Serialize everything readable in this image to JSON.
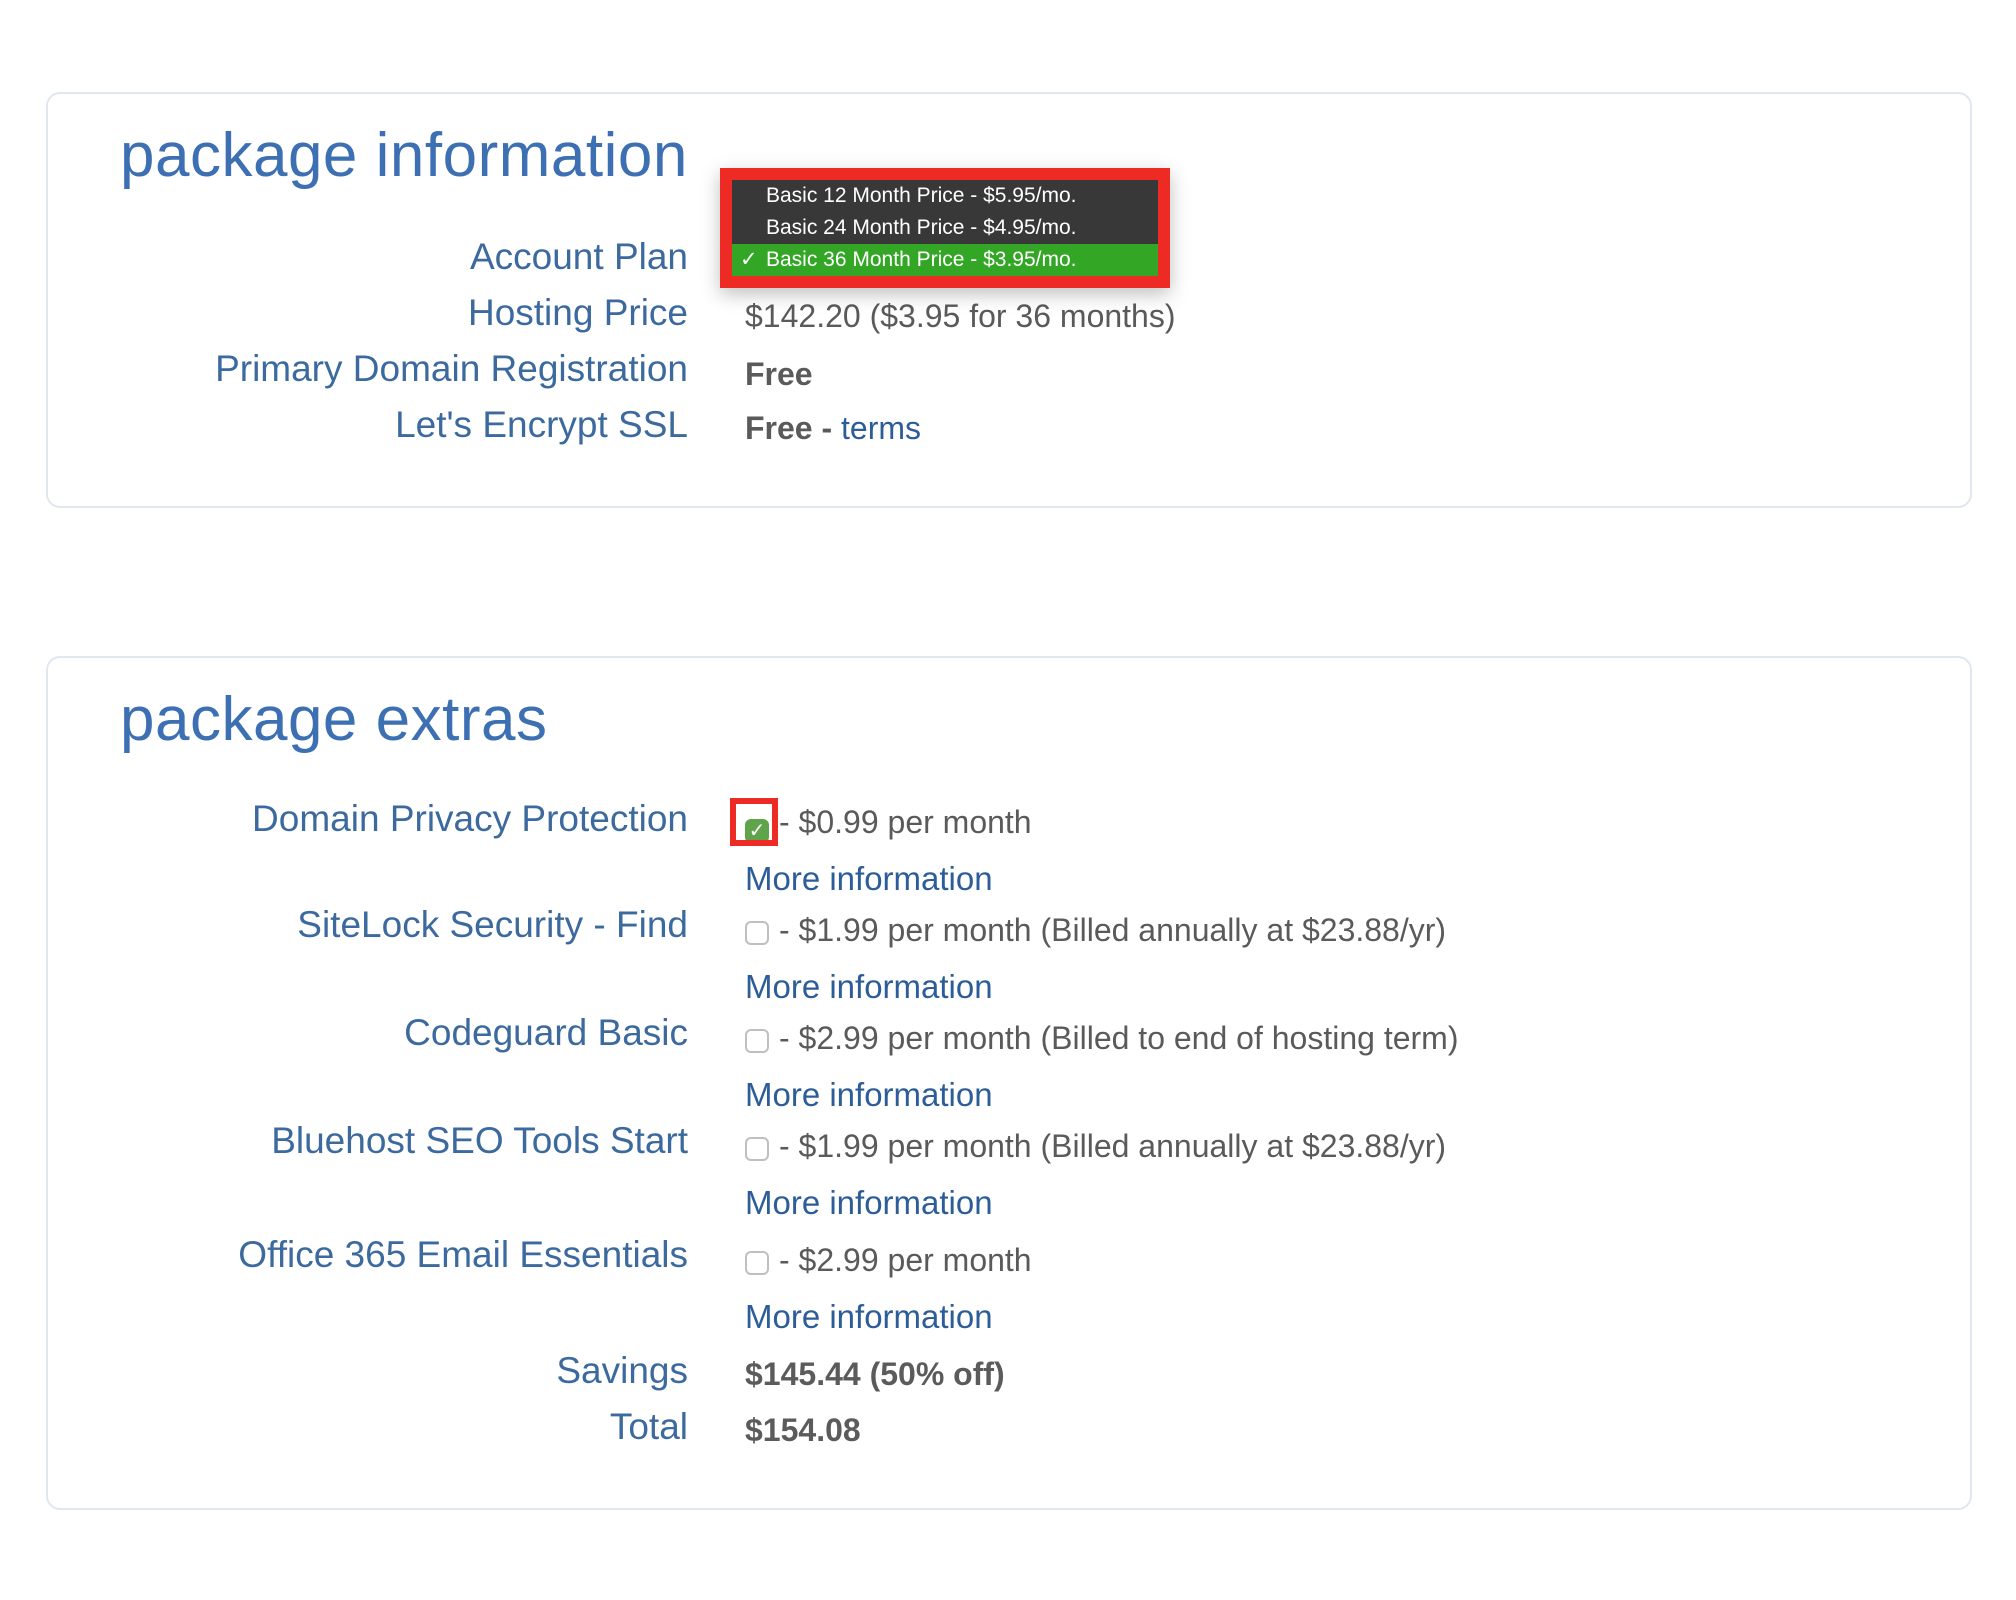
{
  "package_information": {
    "title": "package information",
    "rows": [
      {
        "label": "Account Plan"
      },
      {
        "label": "Hosting Price",
        "value": "$142.20  ($3.95 for 36 months)"
      },
      {
        "label": "Primary Domain Registration",
        "value": "Free"
      },
      {
        "label": "Let's Encrypt SSL",
        "value": "Free - ",
        "link": "terms"
      }
    ],
    "account_plan_dropdown": {
      "options": [
        "Basic 12 Month Price - $5.95/mo.",
        "Basic 24 Month Price - $4.95/mo.",
        "Basic 36 Month Price - $3.95/mo."
      ],
      "selected_index": 2,
      "selected_check": "✓"
    }
  },
  "package_extras": {
    "title": "package extras",
    "items": [
      {
        "label": "Domain Privacy Protection",
        "checked": true,
        "price": "- $0.99 per month",
        "more": "More information"
      },
      {
        "label": "SiteLock Security - Find",
        "checked": false,
        "price": "- $1.99 per month (Billed annually at $23.88/yr)",
        "more": "More information"
      },
      {
        "label": "Codeguard Basic",
        "checked": false,
        "price": "- $2.99 per month (Billed to end of hosting term)",
        "more": "More information"
      },
      {
        "label": "Bluehost SEO Tools Start",
        "checked": false,
        "price": "- $1.99 per month (Billed annually at $23.88/yr)",
        "more": "More information"
      },
      {
        "label": "Office 365 Email Essentials",
        "checked": false,
        "price": "- $2.99 per month",
        "more": "More information"
      }
    ],
    "savings": {
      "label": "Savings",
      "value": "$145.44 (50% off)"
    },
    "total": {
      "label": "Total",
      "value": "$154.08"
    },
    "check_glyph": "✓"
  },
  "colors": {
    "heading": "#3d6fb3",
    "label": "#3c6a9e",
    "link": "#2d5d99",
    "highlight": "#ee2a24",
    "selected_option": "#34a626",
    "checkbox_checked": "#5fa34a"
  }
}
